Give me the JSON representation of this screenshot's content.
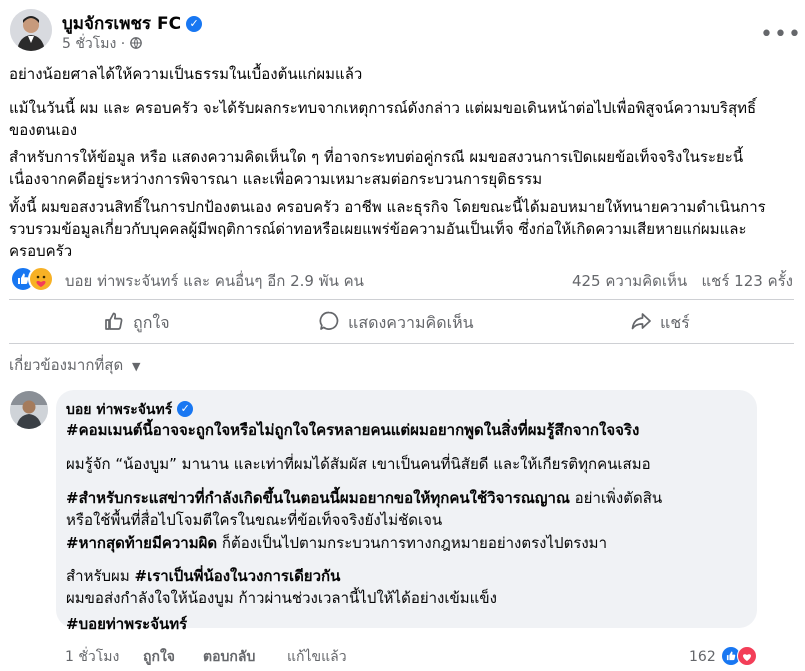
{
  "post": {
    "author": "บูมจักรเพชร FC",
    "time": "5 ชั่วโมง",
    "more_icon": "more-horizontal-icon",
    "paragraphs": [
      [
        "อย่างน้อยศาลได้ให้ความเป็นธรรมในเบื้องต้นแก่ผมแล้ว"
      ],
      [
        "แม้ในวันนี้ ผม และ ครอบครัว จะได้รับผลกระทบจากเหตุการณ์ดังกล่าว แต่ผมขอเดินหน้าต่อไปเพื่อพิสูจน์ความบริสุทธิ์",
        "ของตนเอง"
      ],
      [
        "สำหรับการให้ข้อมูล หรือ แสดงความคิดเห็นใด ๆ ที่อาจกระทบต่อคู่กรณี ผมขอสงวนการเปิดเผยข้อเท็จจริงในระยะนี้",
        "เนื่องจากคดีอยู่ระหว่างการพิจารณา และเพื่อความเหมาะสมต่อกระบวนการยุติธรรม"
      ],
      [
        "ทั้งนี้ ผมขอสงวนสิทธิ์ในการปกป้องตนเอง ครอบครัว อาชีพ และธุรกิจ โดยขณะนี้ได้มอบหมายให้ทนายความดำเนินการ",
        "รวบรวมข้อมูลเกี่ยวกับบุคคลผู้มีพฤติการณ์ด่าทอหรือเผยแพร่ข้อความอันเป็นเท็จ ซึ่งก่อให้เกิดความเสียหายแก่ผมและ",
        "ครอบครัว"
      ]
    ],
    "reactions_text": "บอย ท่าพระจันทร์ และ คนอื่นๆ อีก 2.9 พัน คน",
    "comments_count": "425 ความคิดเห็น",
    "shares_count": "แชร์ 123 ครั้ง",
    "actions": {
      "like": "ถูกใจ",
      "comment": "แสดงความคิดเห็น",
      "share": "แชร์"
    },
    "comment_filter": "เกี่ยวข้องมากที่สุด"
  },
  "comment": {
    "author": "บอย ท่าพระจันทร์",
    "lines": [
      {
        "bold": "#คอมเมนต์นี้อาจจะถูกใจหรือไม่ถูกใจใครหลายคนแต่ผมอยากพูดในสิ่งที่ผมรู้สึกจากใจจริง",
        "rest": ""
      },
      {
        "bold": "",
        "rest": "ผมรู้จัก “น้องบูม” มานาน และเท่าที่ผมได้สัมผัส เขาเป็นคนที่นิสัยดี และให้เกียรติทุกคนเสมอ"
      },
      {
        "bold": "#สำหรับกระแสข่าวที่กำลังเกิดขึ้นในตอนนี้ผมอยากขอให้ทุกคนใช้วิจารณญาณ",
        "rest": " อย่าเพิ่งตัดสิน"
      },
      {
        "bold": "",
        "rest": "หรือใช้พื้นที่สื่อไปโจมตีใครในขณะที่ข้อเท็จจริงยังไม่ชัดเจน"
      },
      {
        "bold": "#หากสุดท้ายมีความผิด",
        "rest": " ก็ต้องเป็นไปตามกระบวนการทางกฎหมายอย่างตรงไปตรงมา"
      },
      {
        "prefix": "สำหรับผม ",
        "bold": "#เราเป็นพี่น้องในวงการเดียวกัน",
        "rest": ""
      },
      {
        "bold": "",
        "rest": "ผมขอส่งกำลังใจให้น้องบูม ก้าวผ่านช่วงเวลานี้ไปให้ได้อย่างเข้มแข็ง"
      },
      {
        "bold": "#บอยท่าพระจันทร์",
        "rest": ""
      }
    ],
    "time": "1 ชั่วโมง",
    "like": "ถูกใจ",
    "reply": "ตอบกลับ",
    "edited": "แก้ไขแล้ว",
    "reaction_count": "162"
  }
}
